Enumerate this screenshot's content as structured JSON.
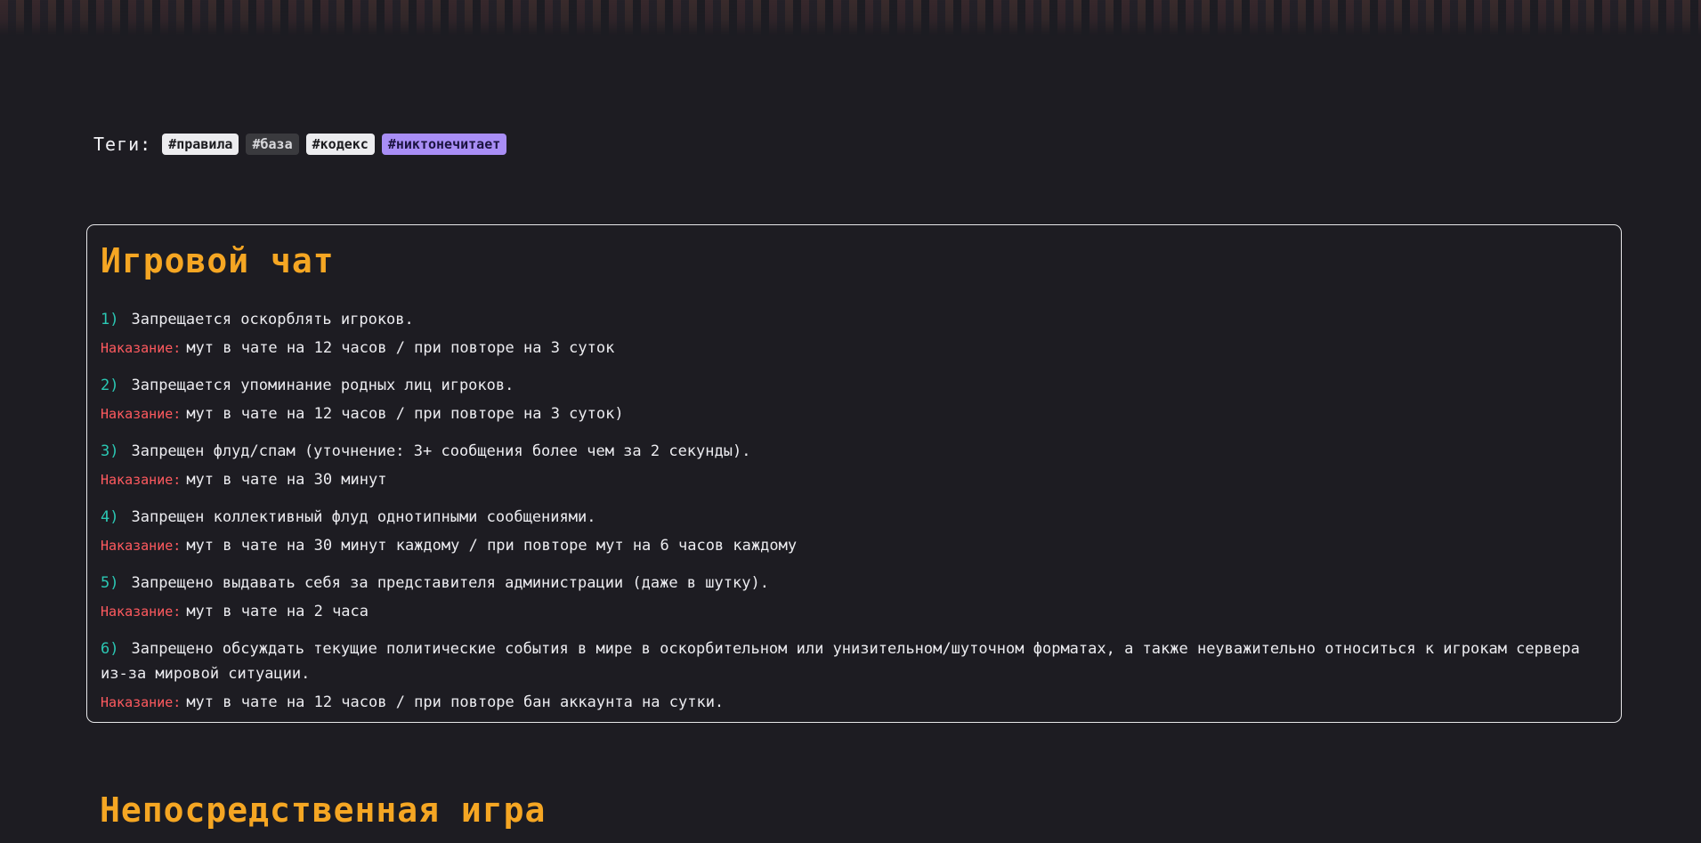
{
  "tags": {
    "label": "Теги:",
    "items": [
      {
        "text": "#правила",
        "style": "light"
      },
      {
        "text": "#база",
        "style": "dark"
      },
      {
        "text": "#кодекс",
        "style": "light"
      },
      {
        "text": "#никтонечитает",
        "style": "purple"
      }
    ]
  },
  "section1": {
    "title": "Игровой чат",
    "punish_label": "Наказание:",
    "rules": [
      {
        "num": "1)",
        "text": "Запрещается оскорблять игроков.",
        "punishment": "мут в чате на 12 часов / при повторе на 3 суток"
      },
      {
        "num": "2)",
        "text": "Запрещается упоминание родных лиц игроков.",
        "punishment": "мут в чате на 12 часов / при повторе на 3 суток)"
      },
      {
        "num": "3)",
        "text": "Запрещен флуд/спам (уточнение: 3+ сообщения более чем за 2 секунды).",
        "punishment": "мут в чате на 30 минут"
      },
      {
        "num": "4)",
        "text": "Запрещен коллективный флуд однотипными сообщениями.",
        "punishment": "мут в чате на 30 минут каждому / при повторе мут на 6 часов каждому"
      },
      {
        "num": "5)",
        "text": "Запрещено выдавать себя за представителя администрации (даже в шутку).",
        "punishment": "мут в чате на 2 часа"
      },
      {
        "num": "6)",
        "text": "Запрещено обсуждать текущие политические события в мире в оскорбительном или унизительном/шуточном форматах, а также неуважительно относиться к игрокам сервера из-за мировой ситуации.",
        "punishment": "мут в чате на 12 часов / при повторе бан аккаунта на сутки."
      }
    ]
  },
  "section2": {
    "title": "Непосредственная игра"
  },
  "colors": {
    "background": "#1d1c22",
    "title": "#f5a623",
    "rule_number": "#2bc8b4",
    "punish_label": "#ff5a5f",
    "tag_purple": "#a98ef6"
  }
}
